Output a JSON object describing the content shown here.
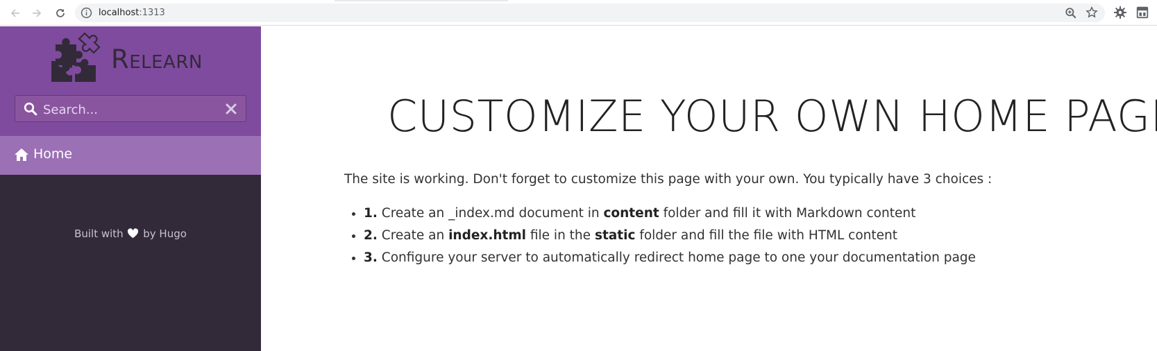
{
  "browser": {
    "url_host": "localhost",
    "url_port": ":1313",
    "icons": [
      "back-icon",
      "forward-icon",
      "reload-icon",
      "info-icon",
      "zoom-icon",
      "star-icon",
      "extension-icon",
      "extension-icon"
    ]
  },
  "sidebar": {
    "logo_text": "Relearn",
    "search_placeholder": "Search...",
    "menu": [
      {
        "label": "Home",
        "icon": "home-icon"
      }
    ],
    "footer": {
      "before": "Built with",
      "after": "by Hugo"
    }
  },
  "main": {
    "title": "CUSTOMIZE YOUR OWN HOME PAGE",
    "intro": "The site is working. Don't forget to customize this page with your own. You typically have 3 choices :",
    "choices": [
      {
        "num": "1.",
        "t1": "Create an _index.md document in ",
        "b1": "content",
        "t2": " folder and fill it with Markdown content"
      },
      {
        "num": "2.",
        "t1": "Create an ",
        "b1": "index.html",
        "t2": " file in the ",
        "b2": "static",
        "t3": " folder and fill the file with HTML content"
      },
      {
        "num": "3.",
        "t1": "Configure your server to automatically redirect home page to one your documentation page"
      }
    ]
  },
  "colors": {
    "sidebar_header": "#7f4b9e",
    "sidebar_active": "#9b70b4",
    "sidebar_body": "#322a38"
  }
}
